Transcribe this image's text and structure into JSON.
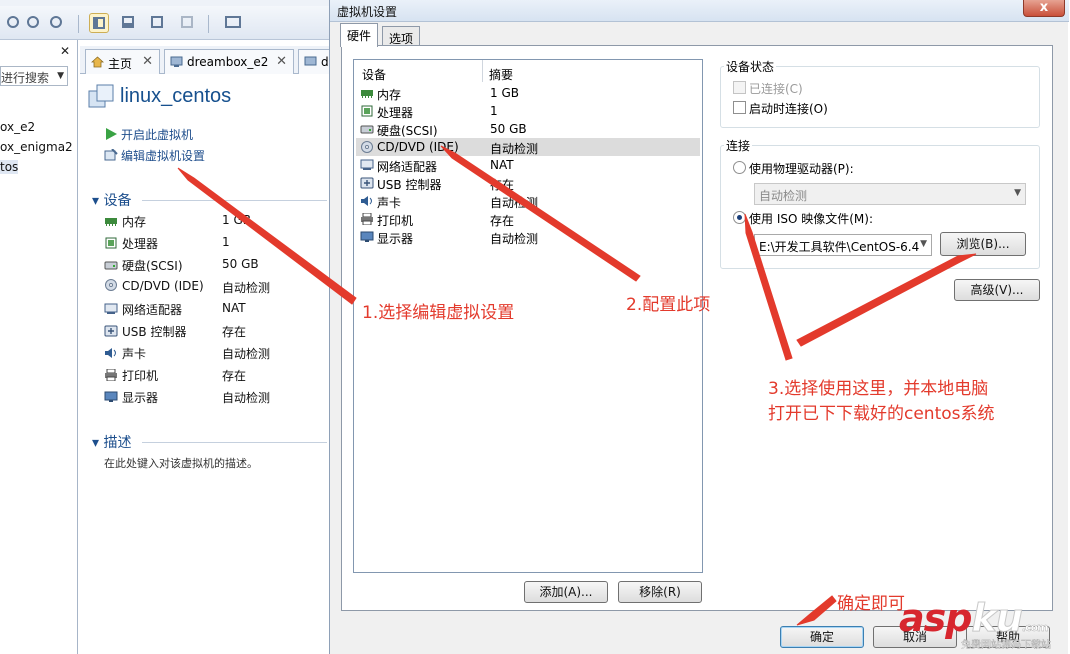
{
  "background_window": {
    "library": {
      "search_placeholder": "进行搜索",
      "items": [
        {
          "label": "ox_e2"
        },
        {
          "label": "ox_enigma2"
        },
        {
          "label": "tos"
        }
      ]
    },
    "tabs": [
      {
        "label": "主页"
      },
      {
        "label": "dreambox_e2"
      },
      {
        "label": "d"
      }
    ],
    "vm_title": "linux_centos",
    "actions": [
      {
        "label": "开启此虚拟机",
        "icon": "play-icon"
      },
      {
        "label": "编辑虚拟机设置",
        "icon": "edit-settings-icon"
      }
    ],
    "devices_section": {
      "title": "设备",
      "rows": [
        {
          "name": "内存",
          "value": "1 GB",
          "icon": "memory-icon"
        },
        {
          "name": "处理器",
          "value": "1",
          "icon": "cpu-icon"
        },
        {
          "name": "硬盘(SCSI)",
          "value": "50 GB",
          "icon": "hdd-icon"
        },
        {
          "name": "CD/DVD (IDE)",
          "value": "自动检测",
          "icon": "cd-icon"
        },
        {
          "name": "网络适配器",
          "value": "NAT",
          "icon": "network-icon"
        },
        {
          "name": "USB 控制器",
          "value": "存在",
          "icon": "usb-icon"
        },
        {
          "name": "声卡",
          "value": "自动检测",
          "icon": "sound-icon"
        },
        {
          "name": "打印机",
          "value": "存在",
          "icon": "printer-icon"
        },
        {
          "name": "显示器",
          "value": "自动检测",
          "icon": "monitor-icon"
        }
      ]
    },
    "description_section": {
      "title": "描述",
      "text": "在此处键入对该虚拟机的描述。"
    }
  },
  "dialog": {
    "title": "虚拟机设置",
    "close_label": "x",
    "tabs": [
      {
        "label": "硬件",
        "active": true
      },
      {
        "label": "选项",
        "active": false
      }
    ],
    "device_list": {
      "col_device": "设备",
      "col_summary": "摘要",
      "rows": [
        {
          "name": "内存",
          "value": "1 GB",
          "icon": "memory-icon"
        },
        {
          "name": "处理器",
          "value": "1",
          "icon": "cpu-icon"
        },
        {
          "name": "硬盘(SCSI)",
          "value": "50 GB",
          "icon": "hdd-icon"
        },
        {
          "name": "CD/DVD (IDE)",
          "value": "自动检测",
          "icon": "cd-icon",
          "selected": true
        },
        {
          "name": "网络适配器",
          "value": "NAT",
          "icon": "network-icon"
        },
        {
          "name": "USB 控制器",
          "value": "存在",
          "icon": "usb-icon"
        },
        {
          "name": "声卡",
          "value": "自动检测",
          "icon": "sound-icon"
        },
        {
          "name": "打印机",
          "value": "存在",
          "icon": "printer-icon"
        },
        {
          "name": "显示器",
          "value": "自动检测",
          "icon": "monitor-icon"
        }
      ],
      "add_button": "添加(A)...",
      "remove_button": "移除(R)"
    },
    "device_status": {
      "title": "设备状态",
      "connected": "已连接(C)",
      "connect_at_power_on": "启动时连接(O)"
    },
    "connection": {
      "title": "连接",
      "use_physical_drive": "使用物理驱动器(P):",
      "physical_drive_value": "自动检测",
      "use_iso": "使用 ISO 映像文件(M):",
      "iso_path": "E:\\开发工具软件\\CentOS-6.4",
      "browse_button": "浏览(B)...",
      "selected_option": "iso"
    },
    "advanced_button": "高级(V)...",
    "ok_button": "确定",
    "cancel_button": "取消",
    "help_button": "帮助"
  },
  "annotations": {
    "step1": "1.选择编辑虚拟设置",
    "step2": "2.配置此项",
    "step3_line1": "3.选择使用这里，并本地电脑",
    "step3_line2": "打开已下下载好的centos系统",
    "step4": "确定即可",
    "color": "#e33a2c"
  },
  "watermark": {
    "logo_asp": "asp",
    "logo_ku": "ku",
    "logo_suffix": ".com",
    "subtitle": "免费网站源码下载站"
  }
}
